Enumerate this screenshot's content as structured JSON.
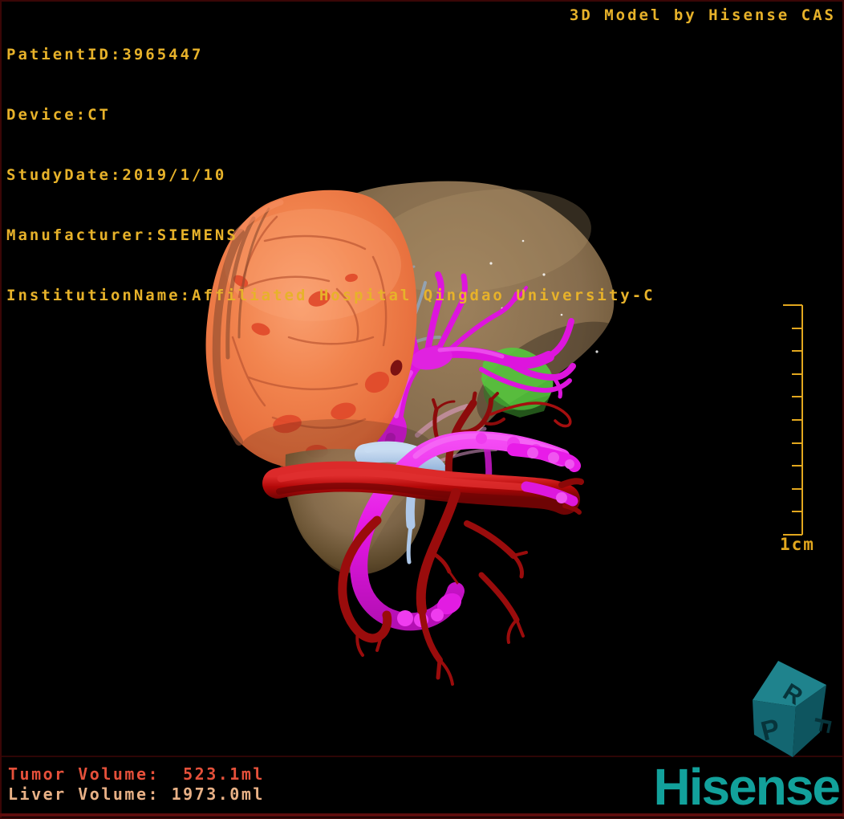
{
  "view": {
    "title": "3D Model by Hisense CAS",
    "scale_label": "1cm"
  },
  "patient_info": {
    "lines": [
      "PatientID:3965447",
      "Device:CT",
      "StudyDate:2019/1/10",
      "Manufacturer:SIEMENS",
      "InstitutionName:Affiliated Hospital Qingdao University-C"
    ]
  },
  "measurements": {
    "tumor_volume_line": "Tumor Volume:  523.1ml",
    "liver_volume_line": "Liver Volume: 1973.0ml"
  },
  "branding": {
    "logo_text": "Hisense"
  },
  "orientation_cube": {
    "top_letter": "R",
    "left_letter": "P",
    "right_letter": "F"
  },
  "colors": {
    "overlay_text": "#e7b22a",
    "tumor_text": "#e5503a",
    "liver_text": "#e8b186",
    "scale_bar": "#e2a71e",
    "logo_teal": "#12a19b",
    "cube_teal": "#1f838d",
    "frame_maroon": "#5e0c0c",
    "liver_mesh": "#8a7050",
    "tumor_mesh": "#ef7e4f",
    "tumor_spots": "#e14a2b",
    "hepatic_vein_magenta": "#e316e3",
    "portal_vein_blue": "#9cbbe2",
    "artery_bright_red": "#b30808",
    "artery_dark_red": "#8c0b0b",
    "green_structure": "#57c83e",
    "background": "#000000"
  }
}
